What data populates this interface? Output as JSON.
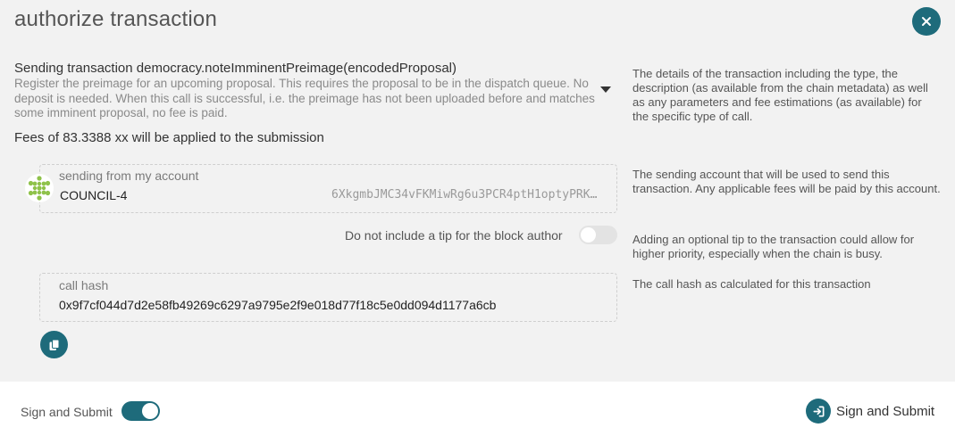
{
  "modal": {
    "title": "authorize transaction",
    "close_icon": "close-icon"
  },
  "transaction": {
    "summary": "Sending transaction democracy.noteImminentPreimage(encodedProposal)",
    "description": "Register the preimage for an upcoming proposal. This requires the proposal to be in the dispatch queue. No deposit is needed. When this call is successful, i.e. the preimage has not been uploaded before and matches some imminent proposal, no fee is paid.",
    "help": "The details of the transaction including the type, the description (as available from the chain metadata) as well as any parameters and fee estimations (as available) for the specific type of call."
  },
  "fees": {
    "text": "Fees of 83.3388 xx will be applied to the submission"
  },
  "account": {
    "label": "sending from my account",
    "name": "COUNCIL-4",
    "address": "6XkgmbJMC34vFKMiwRg6u3PCR4ptH1optyPRK…",
    "help": "The sending account that will be used to send this transaction. Any applicable fees will be paid by this account."
  },
  "tip": {
    "label": "Do not include a tip for the block author",
    "enabled": false,
    "help": "Adding an optional tip to the transaction could allow for higher priority, especially when the chain is busy."
  },
  "call_hash": {
    "label": "call hash",
    "value": "0x9f7cf044d7d2e58fb49269c6297a9795e2f9e018d77f18c5e0dd094d1177a6cb",
    "help": "The call hash as calculated for this transaction"
  },
  "footer": {
    "toggle_label": "Sign and Submit",
    "toggle_on": true,
    "submit_label": "Sign and Submit"
  },
  "colors": {
    "accent": "#1e6b7b",
    "identicon": "#8fc24a"
  }
}
